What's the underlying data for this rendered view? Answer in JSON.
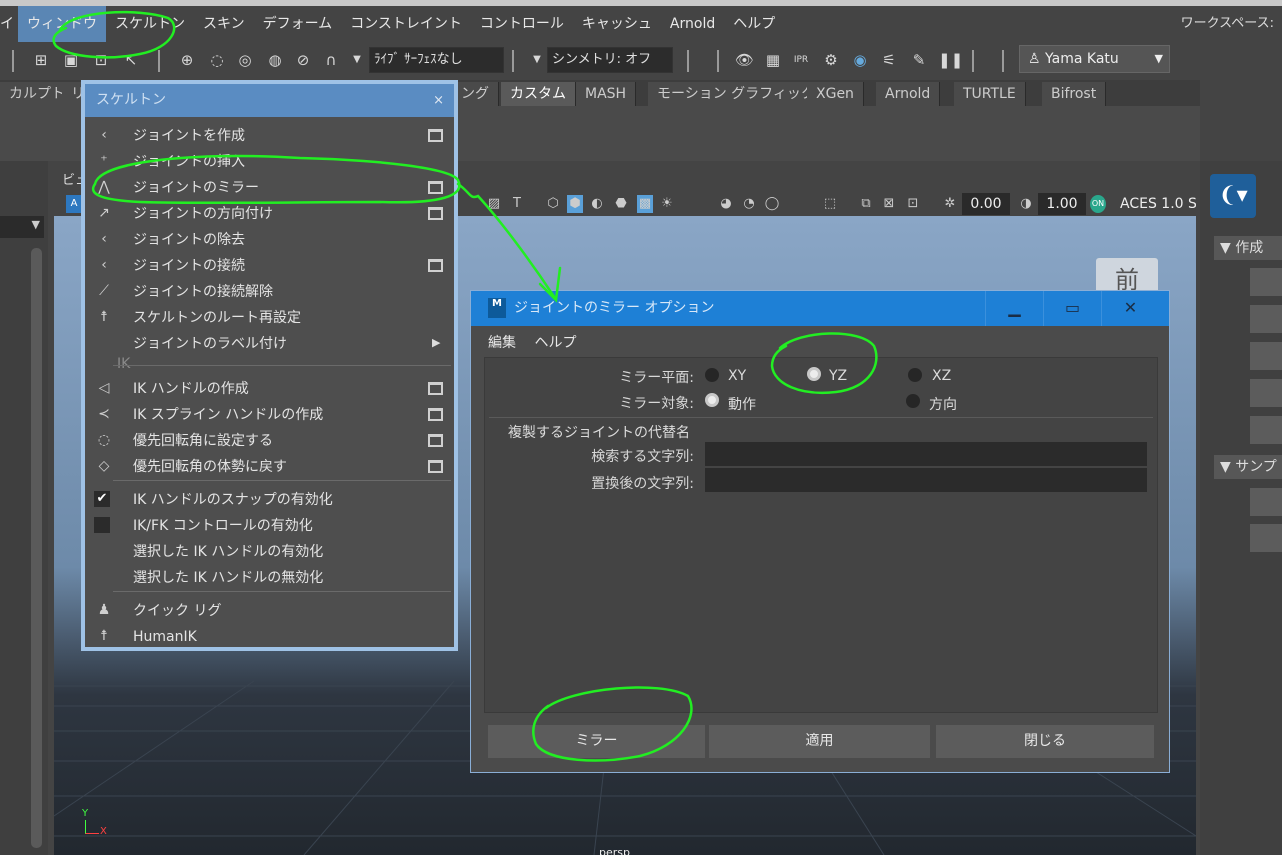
{
  "menubar": {
    "items": [
      {
        "label": "イ"
      },
      {
        "label": "ウィンドウ"
      },
      {
        "label": "スケルトン"
      },
      {
        "label": "スキン"
      },
      {
        "label": "デフォーム"
      },
      {
        "label": "コンストレイント"
      },
      {
        "label": "コントロール"
      },
      {
        "label": "キャッシュ"
      },
      {
        "label": "Arnold"
      },
      {
        "label": "ヘルプ"
      }
    ],
    "workspace_label": "ワークスペース:"
  },
  "toolbar": {
    "live_surface": "ﾗｲﾌﾞ ｻｰﾌｪｽなし",
    "symmetry": "シンメトリ: オフ",
    "user": "Yama Katu"
  },
  "shelf": {
    "tabs": [
      {
        "label": "カルプト"
      },
      {
        "label": "リ"
      },
      {
        "label": "ング"
      },
      {
        "label": "カスタム"
      },
      {
        "label": "MASH"
      },
      {
        "label": "モーション グラフィックス"
      },
      {
        "label": "XGen"
      },
      {
        "label": "Arnold"
      },
      {
        "label": "TURTLE"
      },
      {
        "label": "Bifrost"
      }
    ],
    "active": "カスタム"
  },
  "viewport": {
    "panel_label": "ビュ",
    "field_a": "0.00",
    "field_b": "1.00",
    "color_mgmt": "ACES 1.0 S",
    "view_label": "前",
    "camera": "persp",
    "axis_y": "Y",
    "axis_x": "X"
  },
  "right_panel": {
    "section1": "作成",
    "section2": "サンプ"
  },
  "skeleton_menu": {
    "title": "スケルトン",
    "close": "×",
    "section_ik": "IK",
    "items": [
      {
        "label": "ジョイントを作成",
        "icon": "create-joint-icon"
      },
      {
        "label": "ジョイントの挿入",
        "icon": "insert-joint-icon"
      },
      {
        "label": "ジョイントのミラー",
        "icon": "mirror-joint-icon"
      },
      {
        "label": "ジョイントの方向付け",
        "icon": "orient-joint-icon"
      },
      {
        "label": "ジョイントの除去",
        "icon": "remove-joint-icon"
      },
      {
        "label": "ジョイントの接続",
        "icon": "connect-joint-icon"
      },
      {
        "label": "ジョイントの接続解除",
        "icon": "disconnect-joint-icon"
      },
      {
        "label": "スケルトンのルート再設定",
        "icon": "reroot-icon"
      },
      {
        "label": "ジョイントのラベル付け",
        "icon": "label-icon"
      },
      {
        "label": "IK ハンドルの作成",
        "icon": "ik-handle-icon"
      },
      {
        "label": "IK スプライン ハンドルの作成",
        "icon": "ik-spline-icon"
      },
      {
        "label": "優先回転角に設定する",
        "icon": "set-preferred-angle-icon"
      },
      {
        "label": "優先回転角の体勢に戻す",
        "icon": "assume-preferred-angle-icon"
      },
      {
        "label": "IK ハンドルのスナップの有効化",
        "icon": "checkbox-checked-icon"
      },
      {
        "label": "IK/FK コントロールの有効化",
        "icon": "checkbox-empty-icon"
      },
      {
        "label": "選択した IK ハンドルの有効化",
        "icon": ""
      },
      {
        "label": "選択した IK ハンドルの無効化",
        "icon": ""
      },
      {
        "label": "クイック リグ",
        "icon": "quick-rig-icon"
      },
      {
        "label": "HumanIK",
        "icon": "humanik-icon"
      }
    ]
  },
  "dialog": {
    "title": "ジョイントのミラー オプション",
    "logo_text": "M",
    "menu": {
      "edit": "編集",
      "help": "ヘルプ"
    },
    "mirror_plane_label": "ミラー平面:",
    "mirror_plane_options": [
      "XY",
      "YZ",
      "XZ"
    ],
    "mirror_plane_selected": "YZ",
    "mirror_function_label": "ミラー対象:",
    "mirror_function_options": [
      "動作",
      "方向"
    ],
    "mirror_function_selected": "動作",
    "replacement_section": "複製するジョイントの代替名",
    "search_label": "検索する文字列:",
    "search_value": "",
    "replace_label": "置換後の文字列:",
    "replace_value": "",
    "buttons": {
      "mirror": "ミラー",
      "apply": "適用",
      "close": "閉じる"
    }
  },
  "colors": {
    "annotation": "#22ee22",
    "dialog_title": "#1e80d6",
    "menu_title": "#5a8cc2",
    "active_menu": "#5a86b4"
  }
}
